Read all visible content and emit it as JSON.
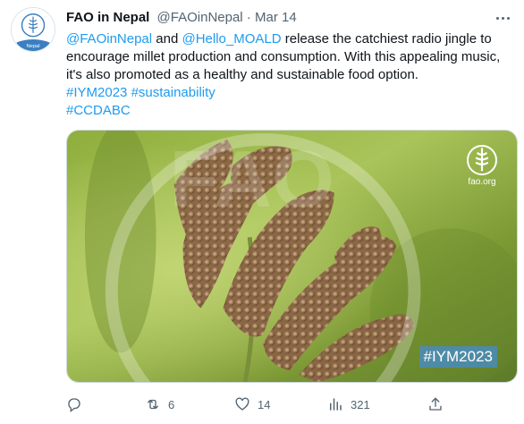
{
  "tweet": {
    "author_name": "FAO in Nepal",
    "handle": "@FAOinNepal",
    "separator": " · ",
    "date": "Mar 14",
    "avatar_label": "Nepal",
    "body": {
      "line1": {
        "mention1": "@FAOinNepal",
        "and": " and ",
        "mention2": "@Hello_MOALD",
        "rest": " release the catchiest radio jingle to encourage millet production and consumption. With this appealing music, it's also promoted as a healthy and sustainable food option."
      },
      "hashtag1": "#IYM2023",
      "hashtag2": "#sustainability",
      "hashtag3": "#CCDABC"
    },
    "media": {
      "logo_text": "fao.org",
      "overlay_hashtag": "#IYM2023"
    },
    "actions": {
      "reply": {
        "icon": "reply-icon",
        "count": ""
      },
      "retweet": {
        "icon": "retweet-icon",
        "count": "6"
      },
      "like": {
        "icon": "heart-icon",
        "count": "14"
      },
      "views": {
        "icon": "views-icon",
        "count": "321"
      },
      "share": {
        "icon": "share-icon",
        "count": ""
      }
    },
    "colors": {
      "link": "#1d9bf0",
      "secondary_text": "#536471",
      "primary_text": "#0f1419"
    }
  }
}
